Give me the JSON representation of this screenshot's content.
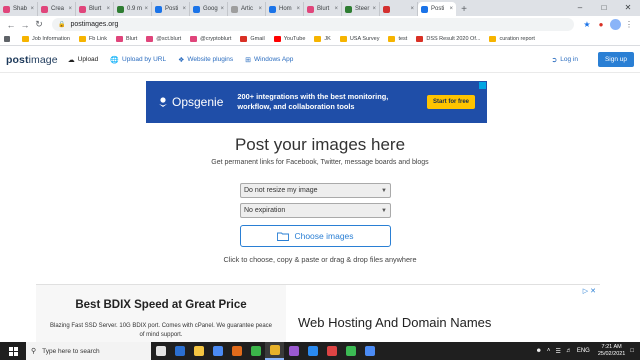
{
  "browser": {
    "tabs": [
      {
        "label": "Shab",
        "color": "#e0457b"
      },
      {
        "label": "Crea",
        "color": "#e0457b"
      },
      {
        "label": "Blurt",
        "color": "#e0457b"
      },
      {
        "label": "0.9 m",
        "color": "#2e7d32"
      },
      {
        "label": "Posti",
        "color": "#1a73e8"
      },
      {
        "label": "Goog",
        "color": "#1a73e8"
      },
      {
        "label": "Artic",
        "color": "#9e9e9e"
      },
      {
        "label": "Hom",
        "color": "#1a73e8"
      },
      {
        "label": "Blurt",
        "color": "#e0457b"
      },
      {
        "label": "Steer",
        "color": "#2e7d32"
      },
      {
        "label": "",
        "color": "#d32f2f"
      },
      {
        "label": "Posti",
        "color": "#1a73e8",
        "active": true
      }
    ],
    "url": "postimages.org",
    "bookmarks": [
      {
        "label": "Job Information",
        "color": "#f6b400"
      },
      {
        "label": "Fb Link",
        "color": "#f6b400"
      },
      {
        "label": "Blurt",
        "color": "#e0457b"
      },
      {
        "label": "@sct.blurt",
        "color": "#e0457b"
      },
      {
        "label": "@cryptoblurt",
        "color": "#e0457b"
      },
      {
        "label": "Gmail",
        "color": "#d93025"
      },
      {
        "label": "YouTube",
        "color": "#ff0000"
      },
      {
        "label": "JK",
        "color": "#f6b400"
      },
      {
        "label": "USA Survey",
        "color": "#f6b400"
      },
      {
        "label": "test",
        "color": "#f6b400"
      },
      {
        "label": "DSS Result 2020 Of...",
        "color": "#d93025"
      },
      {
        "label": "curation report",
        "color": "#f6b400"
      }
    ]
  },
  "site": {
    "logo_bold": "post",
    "logo_light": "image",
    "nav": {
      "upload": "Upload",
      "upload_by_url": "Upload by URL",
      "website_plugins": "Website plugins",
      "windows_app": "Windows App",
      "login": "Log in",
      "signup": "Sign up"
    }
  },
  "banner": {
    "brand": "Opsgenie",
    "text": "200+ integrations with the best monitoring, workflow, and collaboration tools",
    "cta": "Start for free"
  },
  "main": {
    "title": "Post your images here",
    "subtitle": "Get permanent links for Facebook, Twitter, message boards and blogs",
    "resize_select": "Do not resize my image",
    "expiration_select": "No expiration",
    "choose_button": "Choose images",
    "hint": "Click to choose, copy & paste or drag & drop files anywhere"
  },
  "bottom_ad": {
    "headline": "Best BDIX Speed at Great Price",
    "body": "Blazing Fast SSD Server. 10G BDIX port. Comes with cPanel. We guarantee peace of mind support.",
    "right_text": "Web Hosting And Domain Names"
  },
  "taskbar": {
    "search_placeholder": "Type here to search",
    "apps": [
      "#e3e3e3",
      "#2b6fd1",
      "#f4c542",
      "#4b8bf4",
      "#e06b1b",
      "#3bb54a",
      "#e7b12a",
      "#9b59d0",
      "#2a8af0",
      "#d44",
      "#3cba54",
      "#4b8bf4"
    ],
    "lang": "ENG",
    "time": "7:21 AM",
    "date": "25/02/2021"
  }
}
